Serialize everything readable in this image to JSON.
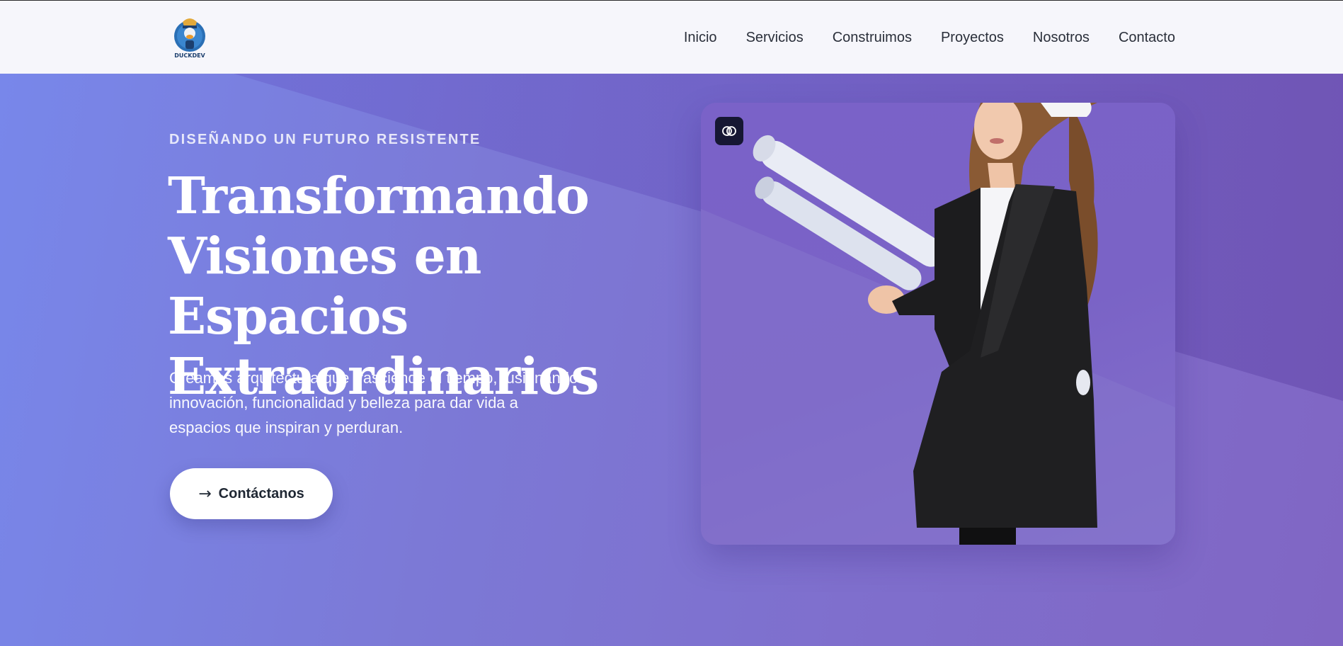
{
  "header": {
    "logo_alt": "DUCKDEV",
    "nav": [
      "Inicio",
      "Servicios",
      "Construimos",
      "Proyectos",
      "Nosotros",
      "Contacto"
    ]
  },
  "hero": {
    "eyebrow": "DISEÑANDO UN FUTURO RESISTENTE",
    "title_lines": [
      "Transformando",
      "Visiones en Espacios",
      "Extraordinarios"
    ],
    "subtitle_lines": [
      "Creamos arquitectura que trasciende el tiempo, fusionando",
      "innovación, funcionalidad y belleza para dar vida a",
      "espacios que inspiran y perduran."
    ],
    "cta_label": "Contáctanos",
    "cta_icon": "arrow-right-icon",
    "image_badge_icon": "brain-icon"
  },
  "colors": {
    "header_bg": "#f6f6fb",
    "hero_gradient_start": "#7887ea",
    "hero_gradient_end": "#8066c4",
    "text_dark": "#1f2733",
    "badge_bg": "#161733"
  }
}
